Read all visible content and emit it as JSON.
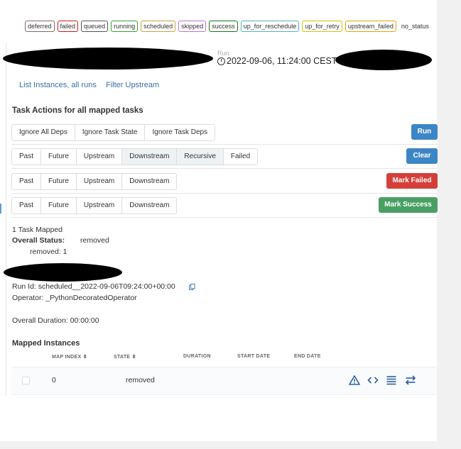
{
  "legend": [
    "deferred",
    "failed",
    "queued",
    "running",
    "scheduled",
    "skipped",
    "success",
    "up_for_reschedule",
    "up_for_retry",
    "upstream_failed",
    "no_status"
  ],
  "legend_colors": [
    "#7f6b6b",
    "#d11a1a",
    "#555555",
    "#2fa52f",
    "#c9a23a",
    "#c76cd6",
    "#157615",
    "#4fb3bf",
    "#d8c200",
    "#e6a300",
    "#333333"
  ],
  "header": {
    "run_label": "Run",
    "run_date": "2022-09-06, 11:24:00 CEST"
  },
  "links": {
    "list_instances": "List Instances, all runs",
    "filter_upstream": "Filter Upstream"
  },
  "task_actions": {
    "title": "Task Actions for all mapped tasks",
    "run_row": [
      "Ignore All Deps",
      "Ignore Task State",
      "Ignore Task Deps"
    ],
    "run_label": "Run",
    "clear_row": [
      "Past",
      "Future",
      "Upstream",
      "Downstream",
      "Recursive",
      "Failed"
    ],
    "clear_label": "Clear",
    "failed_row": [
      "Past",
      "Future",
      "Upstream",
      "Downstream"
    ],
    "failed_label": "Mark Failed",
    "success_row": [
      "Past",
      "Future",
      "Upstream",
      "Downstream"
    ],
    "success_label": "Mark Success"
  },
  "colors": {
    "run": "#3d86c6",
    "clear": "#3d86c6",
    "failed": "#d43f3a",
    "success": "#4a9f64"
  },
  "summary": {
    "mapped": "1 Task Mapped",
    "overall_status_label": "Overall Status:",
    "overall_status_value": "removed",
    "removed_count": "removed: 1"
  },
  "details": {
    "run_id": "Run Id: scheduled__2022-09-06T09:24:00+00:00",
    "operator": "Operator: _PythonDecoratedOperator",
    "duration": "Overall Duration: 00:00:00"
  },
  "mapped_instances": {
    "title": "Mapped Instances",
    "columns": [
      "MAP INDEX",
      "STATE",
      "DURATION",
      "START DATE",
      "END DATE"
    ],
    "row": {
      "map_index": "0",
      "state": "removed"
    },
    "icons": [
      "warning-icon",
      "code-icon",
      "log-icon",
      "dependencies-icon"
    ]
  }
}
